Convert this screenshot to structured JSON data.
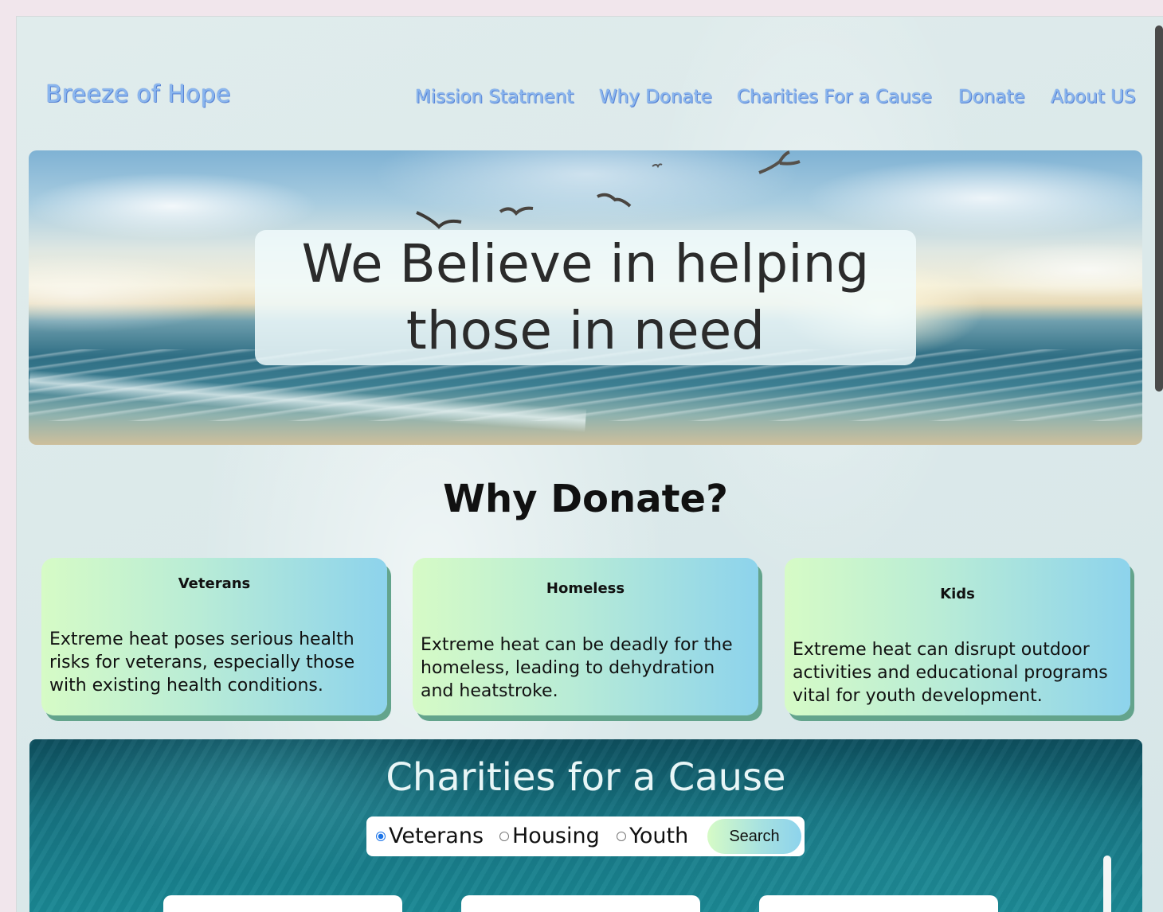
{
  "brand": {
    "title": "Breeze of Hope"
  },
  "nav": {
    "items": [
      {
        "label": "Mission Statment"
      },
      {
        "label": "Why Donate"
      },
      {
        "label": "Charities For a Cause"
      },
      {
        "label": "Donate"
      },
      {
        "label": "About US"
      }
    ]
  },
  "hero": {
    "line1": "We Believe in helping",
    "line2": "those in need"
  },
  "why": {
    "title": "Why Donate?",
    "cards": [
      {
        "title": "Veterans",
        "text": "Extreme heat poses serious health risks for veterans, especially those with existing health conditions."
      },
      {
        "title": "Homeless",
        "text": "Extreme heat can be deadly for the homeless, leading to dehydration and heatstroke."
      },
      {
        "title": "Kids",
        "text": "Extreme heat can disrupt outdoor activities and educational programs vital for youth development."
      }
    ]
  },
  "charities": {
    "title": "Charities for a Cause",
    "options": [
      {
        "label": "Veterans",
        "selected": true
      },
      {
        "label": "Housing",
        "selected": false
      },
      {
        "label": "Youth",
        "selected": false
      }
    ],
    "search_label": "Search"
  },
  "colors": {
    "brand": "#8ab6ee",
    "card_gradient_start": "#d6fbc6",
    "card_gradient_end": "#8dd3ec",
    "card_shadow": "#63a48c",
    "charities_bg": "#177482"
  }
}
